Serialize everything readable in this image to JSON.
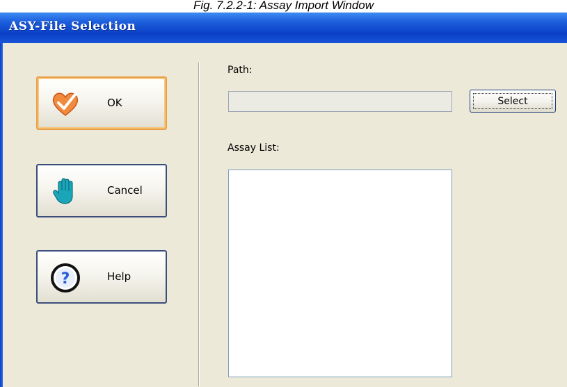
{
  "caption": "Fig. 7.2.2-1: Assay Import Window",
  "window": {
    "title": "ASY-File Selection"
  },
  "buttons": {
    "ok": {
      "label": "OK",
      "icon": "heart-check-icon"
    },
    "cancel": {
      "label": "Cancel",
      "icon": "hand-stop-icon"
    },
    "help": {
      "label": "Help",
      "icon": "help-question-icon"
    }
  },
  "path": {
    "label": "Path:",
    "value": ""
  },
  "select": {
    "label": "Select"
  },
  "assay": {
    "label": "Assay List:",
    "items": []
  },
  "colors": {
    "titlebar": "#0a3fc6",
    "ok_border": "#e8a14a",
    "window_bg": "#ece9d8"
  }
}
